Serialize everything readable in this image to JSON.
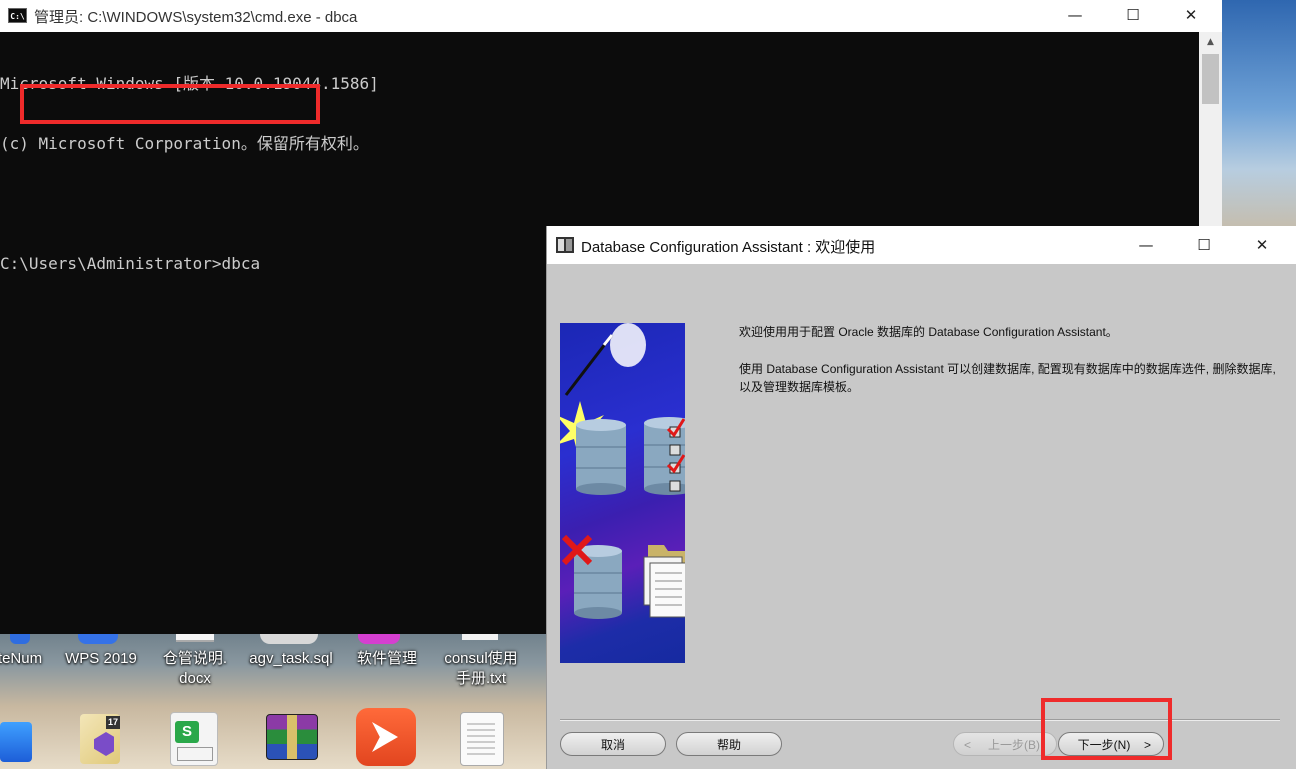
{
  "cmd": {
    "title": "管理员: C:\\WINDOWS\\system32\\cmd.exe - dbca",
    "icon_label": "C:\\",
    "lines": [
      "Microsoft Windows [版本 10.0.19044.1586]",
      "(c) Microsoft Corporation。保留所有权利。",
      "",
      "C:\\Users\\Administrator>dbca"
    ],
    "minimize": "—",
    "maximize": "☐",
    "close": "✕",
    "scroll_up": "▲"
  },
  "desktop": {
    "icons": [
      {
        "label": "teNum",
        "icon": "app-icon"
      },
      {
        "label": "WPS 2019",
        "icon": "wps-icon"
      },
      {
        "label": "仓管说明.\ndocx",
        "icon": "docx-icon"
      },
      {
        "label": "agv_task.sql",
        "icon": "sql-file-icon"
      },
      {
        "label": "软件管理",
        "icon": "software-manager-icon"
      },
      {
        "label": "consul使用\n手册.txt",
        "icon": "txt-file-icon"
      }
    ],
    "bottom_icons": [
      {
        "name": "blue-app-icon"
      },
      {
        "name": "visual-studio-icon",
        "badge": "17"
      },
      {
        "name": "spreadsheet-icon"
      },
      {
        "name": "winrar-icon"
      },
      {
        "name": "presentation-app-icon"
      },
      {
        "name": "blank-document-icon"
      }
    ]
  },
  "dbca": {
    "title": "Database Configuration Assistant : 欢迎使用",
    "minimize": "—",
    "maximize": "☐",
    "close": "✕",
    "para1": "欢迎使用用于配置 Oracle 数据库的 Database Configuration Assistant。",
    "para2": "使用 Database Configuration Assistant 可以创建数据库, 配置现有数据库中的数据库选件, 删除数据库, 以及管理数据库模板。",
    "buttons": {
      "cancel": "取消",
      "help": "帮助",
      "back": "上一步(B)",
      "next": "下一步(N)"
    }
  }
}
